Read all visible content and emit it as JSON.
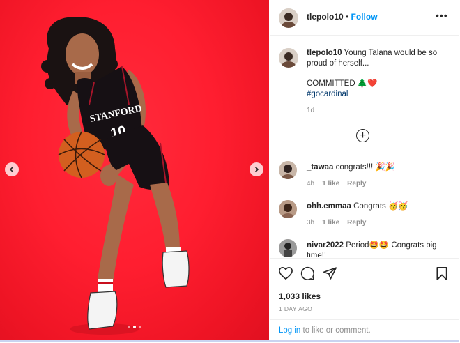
{
  "post": {
    "username": "tlepolo10",
    "follow_label": "Follow",
    "more_icon": "more-options-icon",
    "caption": {
      "username": "tlepolo10",
      "text": "Young Talana would be so proud of herself...",
      "committed": "COMMITTED 🌲❤️",
      "hashtag": "#gocardinal",
      "time": "1d"
    },
    "comments": [
      {
        "username": "_tawaa",
        "text": "congrats!!! 🎉🎉",
        "time": "4h",
        "likes": "1 like",
        "reply": "Reply"
      },
      {
        "username": "ohh.emmaa",
        "text": "Congrats 🥳🥳",
        "time": "3h",
        "likes": "1 like",
        "reply": "Reply"
      },
      {
        "username": "nivar2022",
        "text": "Period🤩🤩 Congrats big time!!",
        "time": "",
        "likes": "",
        "reply": ""
      }
    ],
    "likes": "1,033 likes",
    "posted_ago": "1 DAY AGO",
    "login_link": "Log in",
    "login_suffix": " to like or comment."
  },
  "photo": {
    "jersey_school": "STANFORD",
    "jersey_number": "10",
    "carousel_total": 3,
    "carousel_active": 2
  },
  "colors": {
    "background_red": "#ff1e30",
    "link_blue": "#0095f6",
    "hashtag_blue": "#00376b",
    "muted_gray": "#8e8e8e"
  }
}
